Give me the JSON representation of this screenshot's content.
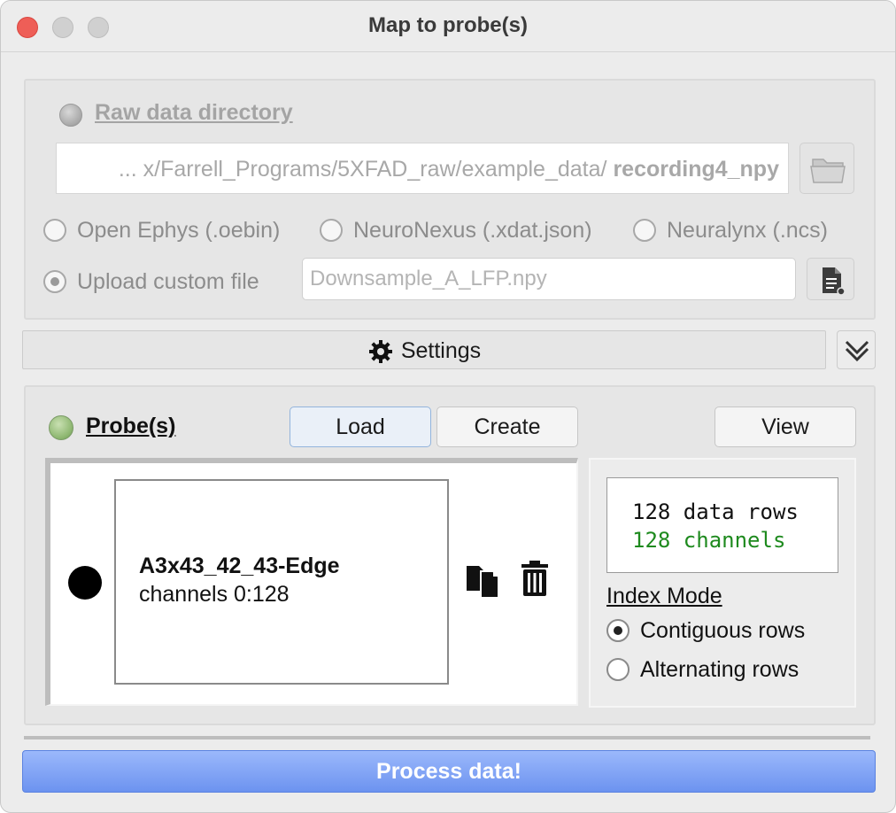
{
  "window": {
    "title": "Map to probe(s)"
  },
  "raw_data": {
    "title": "Raw data directory",
    "path_prefix": "... x/Farrell_Programs/5XFAD_raw/example_data/",
    "path_file": "recording4_npy",
    "formats": [
      {
        "label": "Open Ephys (.oebin)",
        "checked": false
      },
      {
        "label": "NeuroNexus (.xdat.json)",
        "checked": false
      },
      {
        "label": "Neuralynx (.ncs)",
        "checked": false
      }
    ],
    "custom": {
      "label": "Upload custom file",
      "checked": true,
      "placeholder": "Downsample_A_LFP.npy"
    }
  },
  "settings": {
    "label": "Settings"
  },
  "probes": {
    "title": "Probe(s)",
    "load_label": "Load",
    "create_label": "Create",
    "view_label": "View",
    "items": [
      {
        "name": "A3x43_42_43-Edge",
        "channels": "channels 0:128"
      }
    ],
    "info": {
      "rows": "128 data rows",
      "channels": "128 channels"
    },
    "index_mode": {
      "title": "Index Mode",
      "options": [
        {
          "label": "Contiguous rows",
          "checked": true
        },
        {
          "label": "Alternating rows",
          "checked": false
        }
      ]
    }
  },
  "process": {
    "label": "Process data!"
  },
  "colors": {
    "accent": "#6c93f0",
    "channels_text": "#1e8a1e",
    "led_green": "#8fb872"
  },
  "icons": [
    "folder-icon",
    "file-icon",
    "gear-icon",
    "chevron-double-down-icon",
    "copy-icon",
    "trash-icon"
  ]
}
